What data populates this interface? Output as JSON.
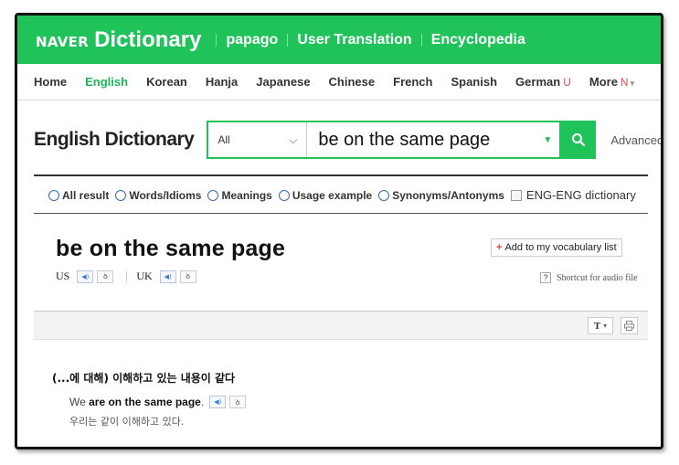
{
  "brand": {
    "naver": "NAVER",
    "product": "Dictionary"
  },
  "topnav": [
    "papago",
    "User Translation",
    "Encyclopedia"
  ],
  "langtabs": {
    "items": [
      "Home",
      "English",
      "Korean",
      "Hanja",
      "Japanese",
      "Chinese",
      "French",
      "Spanish",
      "German",
      "More"
    ],
    "active": "English",
    "german_mark": "U",
    "more_mark": "N"
  },
  "search": {
    "title": "English Dictionary",
    "scope": "All",
    "query": "be on the same page",
    "advanced": "Advanced"
  },
  "filters": {
    "all_result": "All result",
    "words_idioms": "Words/Idioms",
    "meanings": "Meanings",
    "usage": "Usage example",
    "synonyms": "Synonyms/Antonyms",
    "eng_eng": "ENG-ENG dictionary"
  },
  "entry": {
    "headword": "be on the same page",
    "us_label": "US",
    "uk_label": "UK",
    "add_vocab": "Add to my vocabulary list",
    "shortcut_help": "?",
    "shortcut": "Shortcut for audio file"
  },
  "toolbar": {
    "font_label": "T"
  },
  "definition": {
    "meaning": "(...에 대해) 이해하고 있는 내용이 같다",
    "example_pre": "We ",
    "example_bold": "are on the same page",
    "example_post": ".",
    "example_kr": "우리는 같이 이해하고 있다."
  },
  "colors": {
    "brand_green": "#1fc35a",
    "active_tab": "#1fb55a",
    "accent_red": "#e84848"
  }
}
